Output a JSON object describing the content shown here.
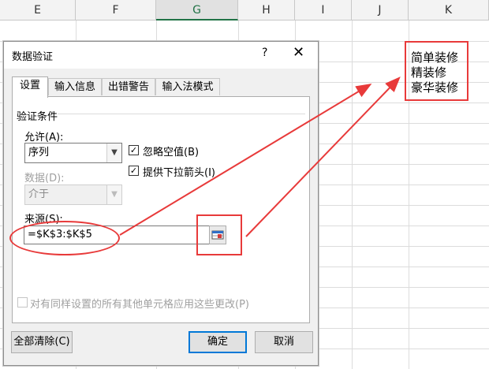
{
  "sheet": {
    "columns": [
      {
        "id": "E",
        "name": "col-header-e",
        "selected": false
      },
      {
        "id": "F",
        "name": "col-header-f",
        "selected": false
      },
      {
        "id": "G",
        "name": "col-header-g",
        "selected": true
      },
      {
        "id": "H",
        "name": "col-header-h",
        "selected": false
      },
      {
        "id": "I",
        "name": "col-header-i",
        "selected": false
      },
      {
        "id": "J",
        "name": "col-header-j",
        "selected": false
      },
      {
        "id": "K",
        "name": "col-header-k",
        "selected": false
      }
    ],
    "k_cells": [
      "简单装修",
      "精装修",
      "豪华装修"
    ]
  },
  "dialog": {
    "title": "数据验证",
    "help": "?",
    "close": "✕",
    "tabs": [
      "设置",
      "输入信息",
      "出错警告",
      "输入法模式"
    ],
    "section_title": "验证条件",
    "allow_label": "允许(A):",
    "allow_value": "序列",
    "data_label": "数据(D):",
    "data_value": "介于",
    "ignore_blank_label": "忽略空值(B)",
    "ignore_blank_checked": "✓",
    "dropdown_label": "提供下拉箭头(I)",
    "dropdown_checked": "✓",
    "source_label": "来源(S):",
    "source_value": "=$K$3:$K$5",
    "apply_all_label": "对有同样设置的所有其他单元格应用这些更改(P)",
    "clear_all_label": "全部清除(C)",
    "ok_label": "确定",
    "cancel_label": "取消"
  },
  "annotation_color": "#e83a3a"
}
